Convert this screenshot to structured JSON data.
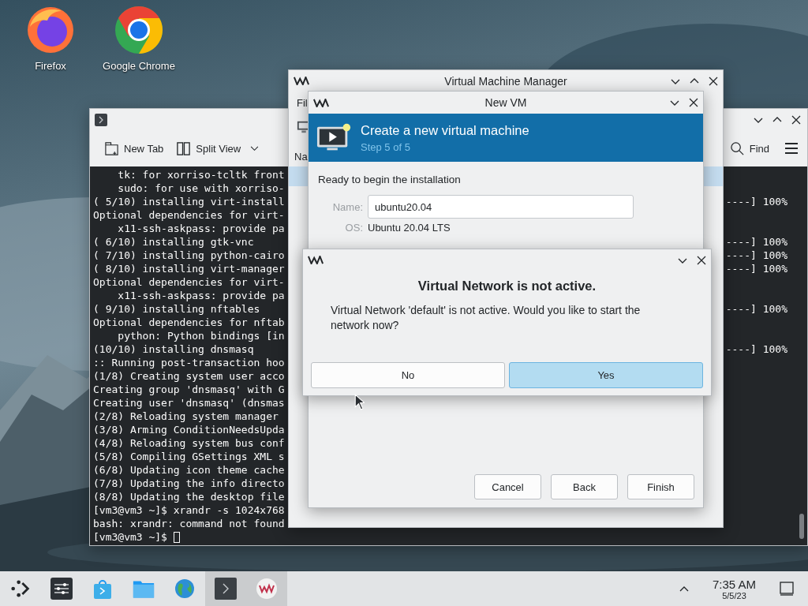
{
  "desktop_icons": [
    {
      "label": "Firefox",
      "kind": "firefox"
    },
    {
      "label": "Google Chrome",
      "kind": "chrome"
    }
  ],
  "terminal": {
    "toolbar": [
      {
        "label": "New Tab",
        "kind": "new-tab"
      },
      {
        "label": "Split View",
        "kind": "split-view"
      }
    ],
    "find": "Find",
    "lines": [
      {
        "text": "    tk: for xorriso-tcltk front"
      },
      {
        "text": "    sudo: for use with xorriso-"
      },
      {
        "text": "( 5/10) installing virt-install",
        "tail": "----] 100%"
      },
      {
        "text": "Optional dependencies for virt-"
      },
      {
        "text": "    x11-ssh-askpass: provide pa"
      },
      {
        "text": "( 6/10) installing gtk-vnc",
        "tail": "----] 100%"
      },
      {
        "text": "( 7/10) installing python-cairo",
        "tail": "----] 100%"
      },
      {
        "text": "( 8/10) installing virt-manager",
        "tail": "----] 100%"
      },
      {
        "text": "Optional dependencies for virt-"
      },
      {
        "text": "    x11-ssh-askpass: provide pa"
      },
      {
        "text": "( 9/10) installing nftables",
        "tail": "----] 100%"
      },
      {
        "text": "Optional dependencies for nftab"
      },
      {
        "text": "    python: Python bindings [in"
      },
      {
        "text": "(10/10) installing dnsmasq",
        "tail": "----] 100%"
      },
      {
        "text": ":: Running post-transaction hoo"
      },
      {
        "text": "(1/8) Creating system user acco"
      },
      {
        "text": "Creating group 'dnsmasq' with G"
      },
      {
        "text": "Creating user 'dnsmasq' (dnsmas"
      },
      {
        "text": "(2/8) Reloading system manager"
      },
      {
        "text": "(3/8) Arming ConditionNeedsUpda"
      },
      {
        "text": "(4/8) Reloading system bus conf"
      },
      {
        "text": "(5/8) Compiling GSettings XML s"
      },
      {
        "text": "(6/8) Updating icon theme cache"
      },
      {
        "text": "(7/8) Updating the info directo"
      },
      {
        "text": "(8/8) Updating the desktop file"
      },
      {
        "text": "[vm3@vm3 ~]$ xrandr -s 1024x768"
      },
      {
        "text": "bash: xrandr: command not found"
      },
      {
        "text": "[vm3@vm3 ~]$"
      }
    ]
  },
  "vmm": {
    "title": "Virtual Machine Manager",
    "menu": "Fil",
    "column": "Na"
  },
  "new_vm": {
    "title": "New VM",
    "header": {
      "title": "Create a new virtual machine",
      "subtitle": "Step 5 of 5"
    },
    "intro": "Ready to begin the installation",
    "fields": [
      {
        "label": "Name:",
        "value": "ubuntu20.04",
        "kind": "input"
      },
      {
        "label": "OS:",
        "value": "Ubuntu 20.04 LTS",
        "kind": "text"
      }
    ],
    "buttons": [
      "Cancel",
      "Back",
      "Finish"
    ]
  },
  "dialog": {
    "title": "Virtual Network is not active.",
    "message": "Virtual Network 'default' is not active. Would you like to start the network now?",
    "buttons": [
      {
        "label": "No",
        "default": false
      },
      {
        "label": "Yes",
        "default": true
      }
    ]
  },
  "taskbar": {
    "items": [
      {
        "kind": "launcher",
        "active": false
      },
      {
        "kind": "settings",
        "active": false
      },
      {
        "kind": "store",
        "active": false
      },
      {
        "kind": "files",
        "active": false
      },
      {
        "kind": "globe",
        "active": false
      },
      {
        "kind": "terminal",
        "active": true
      },
      {
        "kind": "vm",
        "active": true
      }
    ],
    "time": "7:35 AM",
    "date": "5/5/23"
  }
}
